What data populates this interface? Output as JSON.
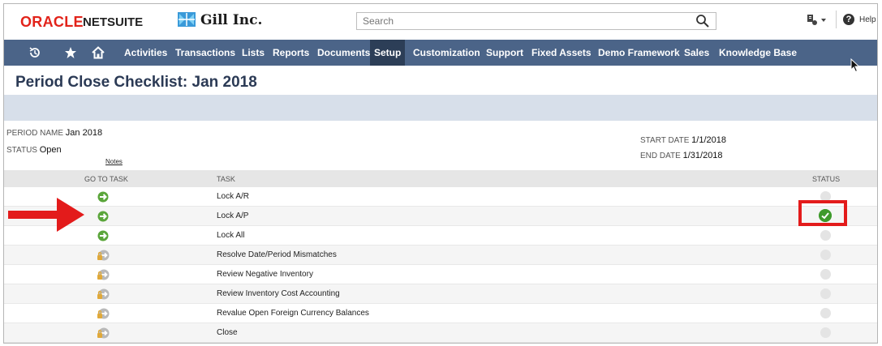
{
  "header": {
    "brand_oracle": "ORACLE",
    "brand_netsuite": "NETSUITE",
    "company": "Gill Inc.",
    "search_placeholder": "Search",
    "help_label": "Help"
  },
  "nav": {
    "items": [
      "Activities",
      "Transactions",
      "Lists",
      "Reports",
      "Documents",
      "Setup",
      "Customization",
      "Support",
      "Fixed Assets",
      "Demo Framework",
      "Sales",
      "Knowledge Base"
    ],
    "active": "Setup"
  },
  "page": {
    "title": "Period Close Checklist: Jan 2018"
  },
  "fields": {
    "period_name_label": "PERIOD NAME",
    "period_name_value": "Jan 2018",
    "status_label": "STATUS",
    "status_value": "Open",
    "notes_link": "Notes",
    "start_date_label": "START DATE",
    "start_date_value": "1/1/2018",
    "end_date_label": "END DATE",
    "end_date_value": "1/31/2018"
  },
  "table": {
    "headers": {
      "go_to_task": "GO TO TASK",
      "task": "TASK",
      "status": "STATUS"
    },
    "rows": [
      {
        "task": "Lock A/R",
        "go_icon": "green-arrow-icon",
        "status": "pending"
      },
      {
        "task": "Lock A/P",
        "go_icon": "green-arrow-icon",
        "status": "complete"
      },
      {
        "task": "Lock All",
        "go_icon": "green-arrow-icon",
        "status": "pending"
      },
      {
        "task": "Resolve Date/Period Mismatches",
        "go_icon": "locked-arrow-icon",
        "status": "pending"
      },
      {
        "task": "Review Negative Inventory",
        "go_icon": "locked-arrow-icon",
        "status": "pending"
      },
      {
        "task": "Review Inventory Cost Accounting",
        "go_icon": "locked-arrow-icon",
        "status": "pending"
      },
      {
        "task": "Revalue Open Foreign Currency Balances",
        "go_icon": "locked-arrow-icon",
        "status": "pending"
      },
      {
        "task": "Close",
        "go_icon": "locked-arrow-icon",
        "status": "pending"
      }
    ]
  },
  "colors": {
    "nav_bg": "#4b6488",
    "nav_active": "#2c3e57",
    "oracle_red": "#e2231a",
    "title": "#2b3a55",
    "complete_green": "#3e9a2c",
    "annotation_red": "#e31b1b"
  }
}
